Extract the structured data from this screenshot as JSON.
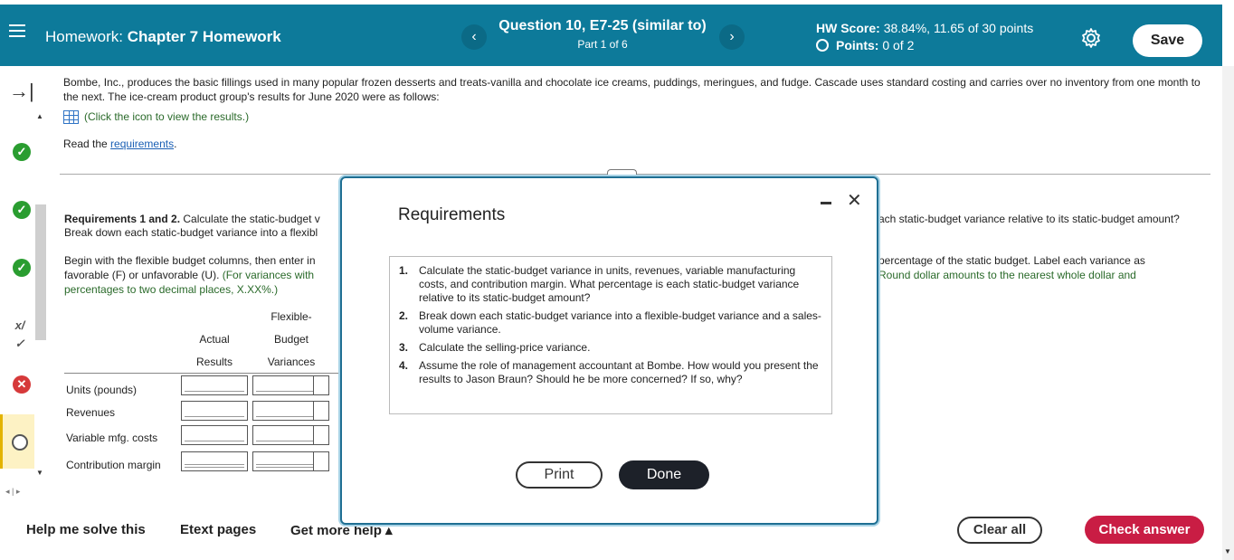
{
  "header": {
    "menu_icon": "hamburger-icon",
    "hw_prefix": "Homework:",
    "hw_name": "Chapter 7 Homework",
    "prev_label": "‹",
    "next_label": "›",
    "question_title": "Question 10, E7-25 (similar to)",
    "question_part": "Part 1 of 6",
    "hw_score_label": "HW Score:",
    "hw_score_value": "38.84%, 11.65 of 30 points",
    "points_label": "Points:",
    "points_value": "0 of 2",
    "settings_icon": "gear-icon",
    "save_label": "Save",
    "colors": {
      "header_bg": "#0d7a9a",
      "check_answer": "#c91d44",
      "done": "#1d2129"
    }
  },
  "rail": {
    "collapse_icon": "→|",
    "status_ok": "✓",
    "status_partial": "x/✓",
    "status_wrong": "✕"
  },
  "content": {
    "intro": "Bombe, Inc., produces the basic fillings used in many popular frozen desserts and treats-vanilla and chocolate ice creams, puddings, meringues, and fudge.  Cascade uses standard costing and carries over no inventory from one month to the next. The ice-cream product group's results for June 2020 were as follows:",
    "click_icon_text": "(Click the icon to view the results.)",
    "read_prefix": "Read the ",
    "read_link": "requirements",
    "read_suffix": ".",
    "req12_bold": "Requirements 1 and 2.",
    "req12_line1": " Calculate the static-budget v",
    "req12_line2": "Break down each static-budget variance into a flexibl",
    "begin_line1": "Begin with the flexible budget columns, then enter in",
    "begin_line2a": "favorable (F) or unfavorable (U). ",
    "begin_line2b": "(For variances with",
    "begin_line3": "percentages to two decimal places, X.XX%.)",
    "right_line1": "ach static-budget variance relative to its static-budget amount?",
    "right_line2": "percentage of the static budget. Label each variance as",
    "right_line3": "Round dollar amounts to the nearest whole dollar and",
    "table": {
      "col1_line1": "Actual",
      "col1_line2": "Results",
      "col2_line0": "Flexible-",
      "col2_line1": "Budget",
      "col2_line2": "Variances",
      "rows": [
        "Units (pounds)",
        "Revenues",
        "Variable mfg. costs",
        "Contribution margin"
      ]
    }
  },
  "footer": {
    "help_label": "Help me solve this",
    "etext_label": "Etext pages",
    "more_help_label": "Get more help ▴",
    "clear_label": "Clear all",
    "check_label": "Check answer"
  },
  "modal": {
    "title": "Requirements",
    "items": [
      {
        "num": "1.",
        "text": "Calculate the static-budget variance in units, revenues, variable manufacturing costs, and contribution margin. What percentage is each static-budget variance relative to its static-budget amount?"
      },
      {
        "num": "2.",
        "text": "Break down each static-budget variance into a flexible-budget variance and a sales-volume variance."
      },
      {
        "num": "3.",
        "text": "Calculate the selling-price variance."
      },
      {
        "num": "4.",
        "text": "Assume the role of management accountant at Bombe. How would you present the results to Jason Braun? Should he be more concerned? If so, why?"
      }
    ],
    "print_label": "Print",
    "done_label": "Done",
    "close_icon": "✕"
  }
}
